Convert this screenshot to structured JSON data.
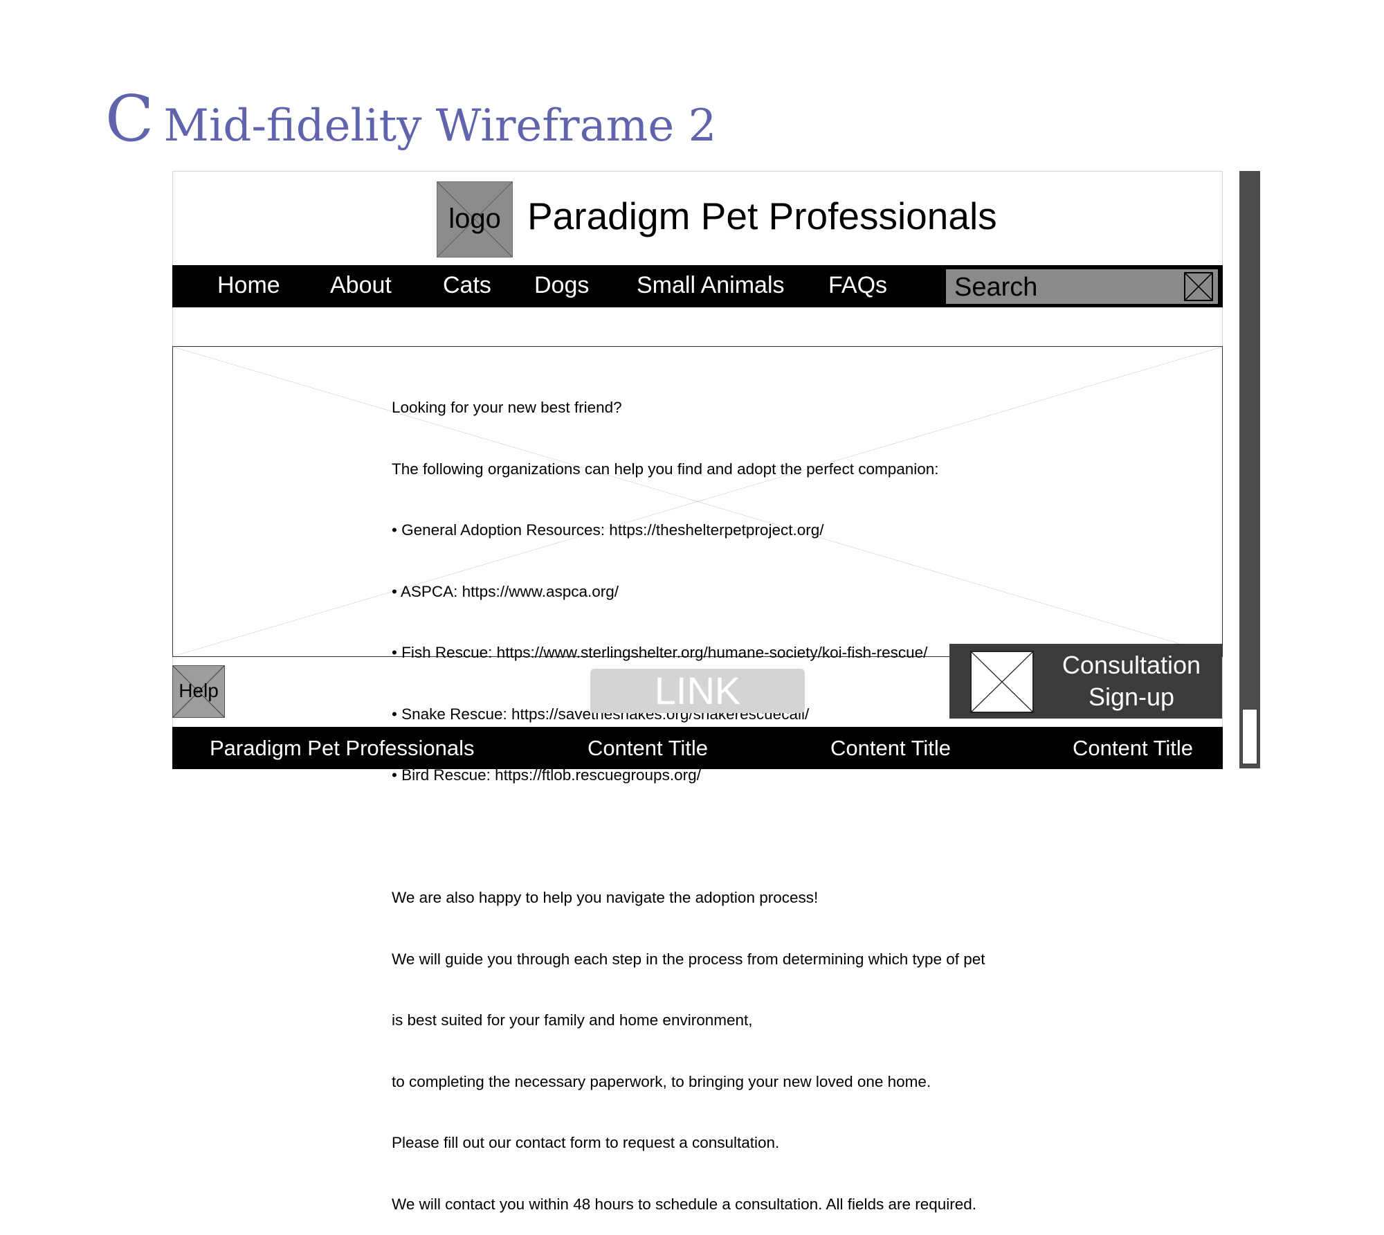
{
  "slide": {
    "letter": "C",
    "title": "Mid-fidelity Wireframe 2"
  },
  "header": {
    "logo_label": "logo",
    "site_title": "Paradigm Pet Professionals"
  },
  "nav": {
    "items": [
      "Home",
      "About",
      "Cats",
      "Dogs",
      "Small Animals",
      "FAQs"
    ],
    "search_placeholder": "Search"
  },
  "hero": {
    "lines": [
      "Looking for your new best friend?",
      "The following organizations can help you find and adopt the perfect companion:",
      "• General Adoption Resources: https://theshelterpetproject.org/",
      "• ASPCA: https://www.aspca.org/",
      "• Fish Rescue: https://www.sterlingshelter.org/humane-society/koi-fish-rescue/",
      "• Snake Rescue: https://savethesnakes.org/snakerescuecall/",
      "• Bird Rescue: https://ftlob.rescuegroups.org/",
      "",
      "We are also happy to help you navigate the adoption process!",
      "We will guide you through each step in the process from determining which type of pet",
      "is best suited for your family and home environment,",
      "to completing the necessary paperwork, to bringing your new loved one home.",
      "Please fill out our contact form to request a consultation.",
      "We will contact you within 48 hours to schedule a consultation. All fields are required."
    ]
  },
  "help_label": "Help",
  "link_label": "LINK",
  "consultation": {
    "line1": "Consultation",
    "line2": "Sign-up"
  },
  "footer": {
    "brand": "Paradigm Pet Professionals",
    "items": [
      "Content Title",
      "Content Title",
      "Content Title"
    ]
  },
  "colors": {
    "title_accent": "#5f64ad",
    "bar": "#000000",
    "consult_bg": "#3b3b3b"
  }
}
